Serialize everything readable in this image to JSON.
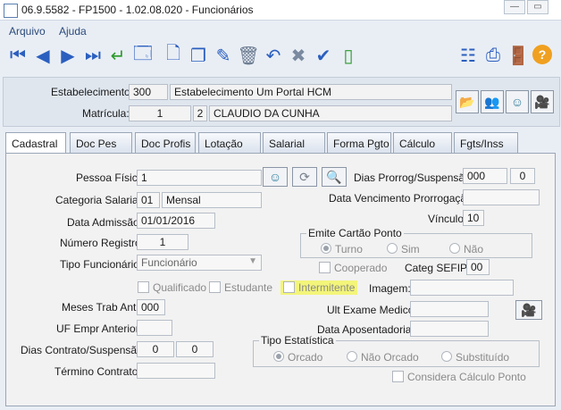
{
  "window": {
    "title": "06.9.5582 - FP1500 - 1.02.08.020 - Funcionários",
    "minimize": "—",
    "restore": "▭"
  },
  "menu": {
    "items": [
      "Arquivo",
      "Ajuda"
    ]
  },
  "toolbar": {
    "icons": [
      "first-icon",
      "prev-icon",
      "next-icon",
      "last-icon",
      "enter-icon",
      "view-icon",
      "new-icon",
      "copy-icon",
      "edit-icon",
      "delete-icon",
      "undo-icon",
      "cancel-icon",
      "confirm-icon",
      "blank-icon",
      "tree-icon",
      "print-icon",
      "exit-icon",
      "help-icon"
    ]
  },
  "header": {
    "estabelecimento_label": "Estabelecimento:",
    "estabelecimento_code": "300",
    "estabelecimento_name": "Estabelecimento Um Portal HCM",
    "matricula_label": "Matrícula:",
    "matricula_num": "1",
    "matricula_dv": "2",
    "matricula_name": "CLAUDIO DA CUNHA"
  },
  "tabs": [
    "Cadastral",
    "Doc Pes",
    "Doc Profis",
    "Lotação",
    "Salarial",
    "Forma Pgto",
    "Cálculo",
    "Fgts/Inss"
  ],
  "form": {
    "pessoa_fisica_label": "Pessoa Física:",
    "pessoa_fisica_value": "1",
    "dias_prorrog_label": "Dias Prorrog/Suspensão:",
    "dias_prorrog_a": "000",
    "dias_prorrog_b": "0",
    "categoria_label": "Categoria Salarial:",
    "categoria_code": "01",
    "categoria_name": "Mensal",
    "data_venc_label": "Data Vencimento Prorrogação:",
    "data_venc_value": "",
    "data_admissao_label": "Data Admissão:",
    "data_admissao_value": "01/01/2016",
    "vinculo_label": "Vínculo:",
    "vinculo_value": "10",
    "numero_registro_label": "Número Registro:",
    "numero_registro_value": "1",
    "emite_cartao_label": "Emite Cartão Ponto",
    "emite_options": [
      "Turno",
      "Sim",
      "Não"
    ],
    "tipo_funcionario_label": "Tipo Funcionário:",
    "tipo_funcionario_value": "Funcionário",
    "cooperado_label": "Cooperado",
    "categ_sefip_label": "Categ SEFIP:",
    "categ_sefip_value": "00",
    "qualificado_label": "Qualificado",
    "estudante_label": "Estudante",
    "intermitente_label": "Intermitente",
    "imagem_label": "Imagem:",
    "meses_trab_label": "Meses Trab Ant:",
    "meses_trab_value": "000",
    "ult_exame_label": "Ult Exame Medico:",
    "uf_empr_label": "UF Empr Anterior:",
    "data_apos_label": "Data Aposentadoria:",
    "dias_contrato_label": "Dias Contrato/Suspensão:",
    "dias_contrato_a": "0",
    "dias_contrato_b": "0",
    "tipo_estatistica_label": "Tipo Estatística",
    "estatistica_options": [
      "Orcado",
      "Não Orcado",
      "Substituído"
    ],
    "termino_label": "Término Contrato:",
    "considera_label": "Considera Cálculo Ponto"
  }
}
